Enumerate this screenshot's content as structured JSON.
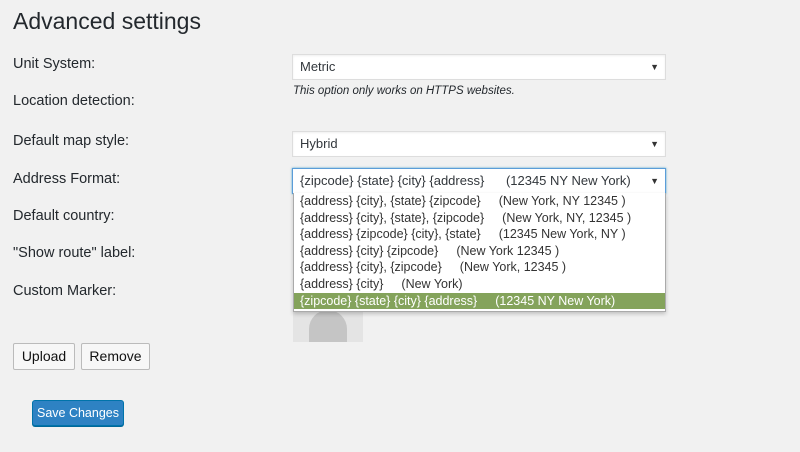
{
  "page": {
    "title": "Advanced settings"
  },
  "fields": {
    "unit_system": {
      "label": "Unit System:",
      "value": "Metric"
    },
    "location_detection": {
      "label": "Location detection:",
      "hint": "This option only works on HTTPS websites."
    },
    "map_style": {
      "label": "Default map style:",
      "value": "Hybrid"
    },
    "address_format": {
      "label": "Address Format:",
      "value": "{zipcode} {state} {city} {address}",
      "value_hint": "(12345 NY New York)",
      "options": [
        {
          "format": "{address} {city}, {state} {zipcode}",
          "example": "(New York, NY 12345 )"
        },
        {
          "format": "{address} {city}, {state}, {zipcode}",
          "example": "(New York, NY, 12345 )"
        },
        {
          "format": "{address} {zipcode} {city}, {state}",
          "example": "(12345 New York, NY )"
        },
        {
          "format": "{address} {city} {zipcode}",
          "example": "(New York 12345 )"
        },
        {
          "format": "{address} {city}, {zipcode}",
          "example": "(New York, 12345 )"
        },
        {
          "format": "{address} {city}",
          "example": "(New York)"
        },
        {
          "format": "{zipcode} {state} {city} {address}",
          "example": "(12345 NY New York)"
        }
      ],
      "selected_index": 6
    },
    "default_country": {
      "label": "Default country:"
    },
    "show_route": {
      "label": "\"Show route\" label:"
    },
    "custom_marker": {
      "label": "Custom Marker:"
    }
  },
  "buttons": {
    "upload": "Upload",
    "remove": "Remove",
    "save": "Save Changes"
  },
  "colors": {
    "selected_option": "#84a35b",
    "primary_button": "#2e82c3"
  }
}
